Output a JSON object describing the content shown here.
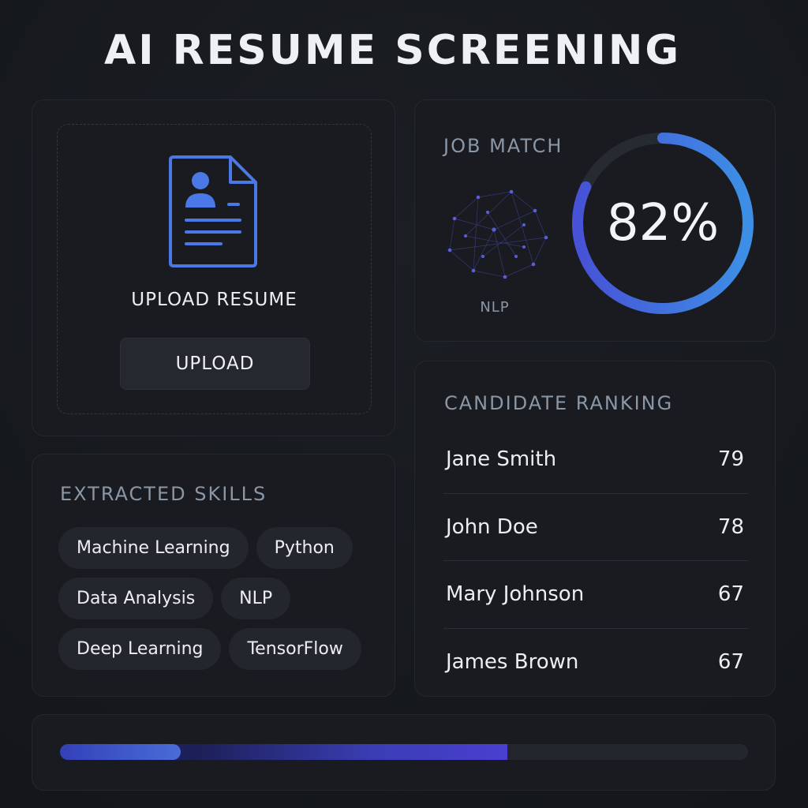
{
  "header": {
    "title": "AI RESUME SCREENING"
  },
  "upload": {
    "icon": "resume-document-icon",
    "heading": "UPLOAD RESUME",
    "button_label": "UPLOAD"
  },
  "job_match": {
    "title": "JOB MATCH",
    "graphic_label": "NLP",
    "percent": 82,
    "display": "82%",
    "accent_color": "#4a78e6"
  },
  "skills": {
    "title": "EXTRACTED SKILLS",
    "rows": [
      [
        "Machine Learning",
        "Python"
      ],
      [
        "Data Analysis",
        "NLP"
      ],
      [
        "Deep Learning",
        "TensorFlow"
      ]
    ]
  },
  "ranking": {
    "title": "CANDIDATE RANKING",
    "candidates": [
      {
        "name": "Jane Smith",
        "score": "79"
      },
      {
        "name": "John Doe",
        "score": "78"
      },
      {
        "name": "Mary Johnson",
        "score": "67"
      },
      {
        "name": "James Brown",
        "score": "67"
      }
    ]
  },
  "progress": {
    "fraction": 0.65,
    "segment_fraction": 0.175
  },
  "colors": {
    "background": "#16181c",
    "card": "#191b20",
    "accent": "#4a78e6",
    "muted_text": "#8a97a6"
  }
}
